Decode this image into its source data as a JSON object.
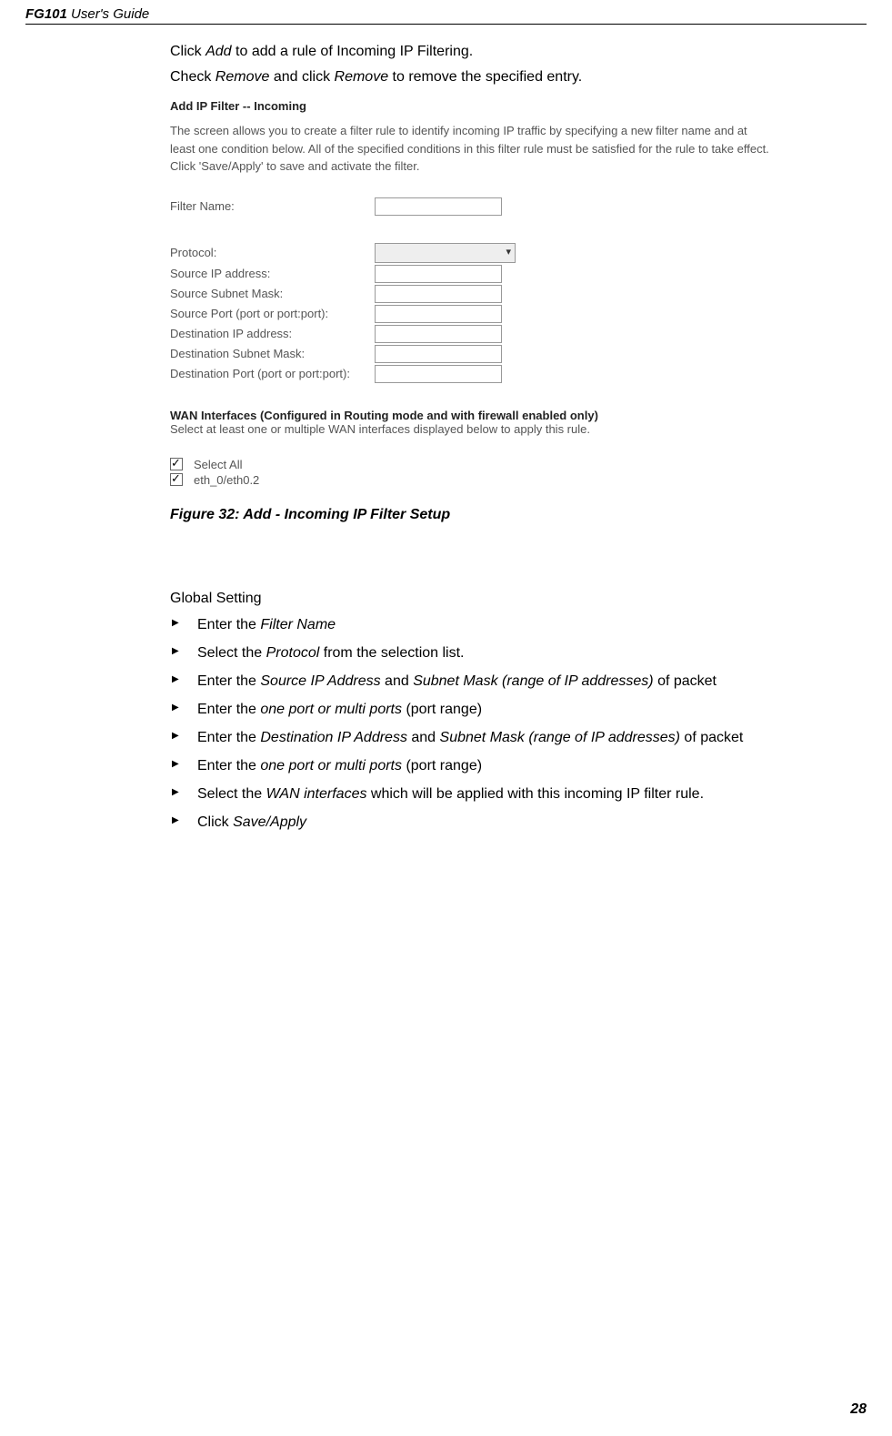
{
  "header": {
    "product": "FG101",
    "rest": " User's Guide"
  },
  "intro": {
    "line1_pre": "Click ",
    "line1_add": "Add",
    "line1_post": " to add a rule of Incoming IP Filtering.",
    "line2_pre": "Check ",
    "line2_rem1": "Remove",
    "line2_mid": " and click ",
    "line2_rem2": "Remove",
    "line2_post": " to remove the specified entry."
  },
  "router": {
    "title": "Add IP Filter -- Incoming",
    "desc": "The screen allows you to create a filter rule to identify incoming IP traffic by specifying a new filter name and at least one condition below. All of the specified conditions in this filter rule must be satisfied for the rule to take effect. Click 'Save/Apply' to save and activate the filter.",
    "labels": {
      "filter_name": "Filter Name:",
      "protocol": "Protocol:",
      "src_ip": "Source IP address:",
      "src_mask": "Source Subnet Mask:",
      "src_port": "Source Port (port or port:port):",
      "dst_ip": "Destination IP address:",
      "dst_mask": "Destination Subnet Mask:",
      "dst_port": "Destination Port (port or port:port):"
    },
    "wan_title": "WAN Interfaces (Configured in Routing mode and with firewall enabled only)",
    "wan_desc": "Select at least one or multiple WAN interfaces displayed below to apply this rule.",
    "chk": {
      "all": "Select All",
      "eth": "eth_0/eth0.2"
    }
  },
  "figure_caption": "Figure 32: Add - Incoming IP Filter Setup",
  "section_title": "Global Setting",
  "bullets": {
    "b1_pre": "Enter the ",
    "b1_it": "Filter Name",
    "b2_pre": "Select the ",
    "b2_it": "Protocol",
    "b2_post": " from the selection list.",
    "b3_pre": "Enter the ",
    "b3_it1": "Source IP Address",
    "b3_mid": " and ",
    "b3_it2": "Subnet Mask (range of IP addresses)",
    "b3_post": " of packet",
    "b4_pre": "Enter the ",
    "b4_it": "one port or multi ports",
    "b4_post": " (port range)",
    "b5_pre": "Enter the ",
    "b5_it1": "Destination IP Address",
    "b5_mid": " and ",
    "b5_it2": "Subnet Mask (range of IP addresses)",
    "b5_post": " of packet",
    "b6_pre": "Enter the ",
    "b6_it": "one port or multi ports",
    "b6_post": " (port range)",
    "b7_pre": "Select the ",
    "b7_it": "WAN interfaces",
    "b7_post": " which will be applied with this incoming IP filter rule.",
    "b8_pre": "Click ",
    "b8_it": "Save/Apply"
  },
  "page_num": "28"
}
